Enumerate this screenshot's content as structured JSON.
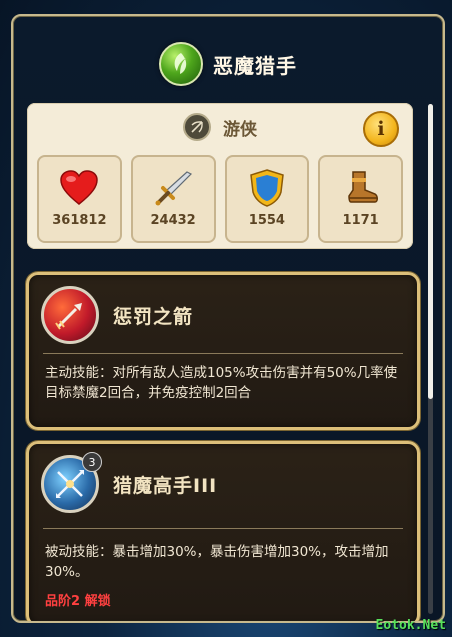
{
  "header": {
    "title": "恶魔猎手",
    "emblem_icon": "leaf-emblem-icon"
  },
  "role": {
    "name": "游侠",
    "icon": "bow-arrow-icon",
    "info_label": "i"
  },
  "stats": [
    {
      "name": "hp",
      "icon": "heart-icon",
      "value": "361812"
    },
    {
      "name": "attack",
      "icon": "sword-icon",
      "value": "24432"
    },
    {
      "name": "defense",
      "icon": "shield-icon",
      "value": "1554"
    },
    {
      "name": "speed",
      "icon": "boot-icon",
      "value": "1171"
    }
  ],
  "skills": [
    {
      "name": "惩罚之箭",
      "icon": "flaming-arrow-icon",
      "description": "主动技能：对所有敌人造成105%攻击伤害并有50%几率使目标禁魔2回合，并免疫控制2回合"
    },
    {
      "name": "猎魔高手III",
      "icon": "crossed-arrows-icon",
      "level_badge": "3",
      "description": "被动技能：暴击增加30%，暴击伤害增加30%，攻击增加30%。",
      "unlock_text": "品阶2 解锁"
    }
  ],
  "watermark": "Eotok.Net",
  "colors": {
    "accent_gold": "#dcbf7a",
    "unlock_red": "#ff4040",
    "card_bg": "#f4ecd8"
  }
}
